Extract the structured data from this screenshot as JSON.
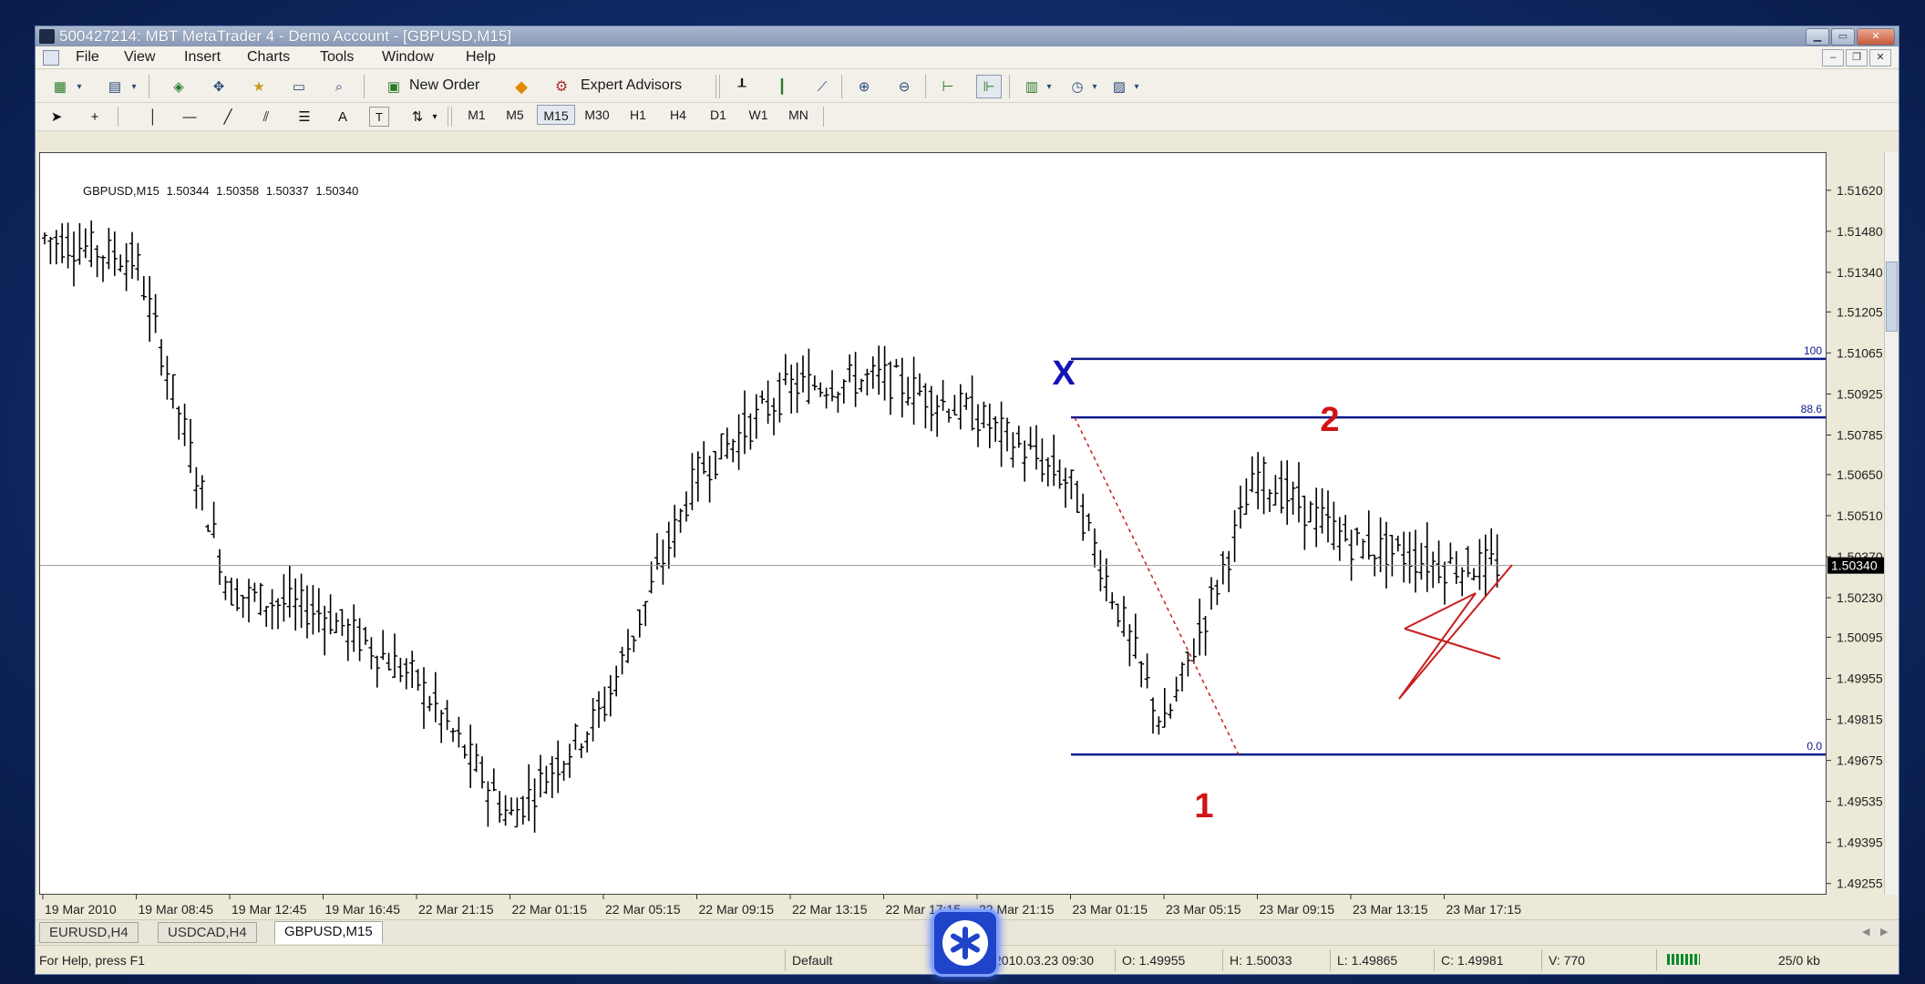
{
  "window": {
    "title": "500427214: MBT MetaTrader 4 - Demo Account - [GBPUSD,M15]",
    "controls": [
      "minimize",
      "maximize",
      "close"
    ]
  },
  "menu": [
    "File",
    "View",
    "Insert",
    "Charts",
    "Tools",
    "Window",
    "Help"
  ],
  "toolbar": {
    "new_order": "New Order",
    "expert_advisors": "Expert Advisors",
    "text_tool": "A",
    "timeframes": [
      "M1",
      "M5",
      "M15",
      "M30",
      "H1",
      "H4",
      "D1",
      "W1",
      "MN"
    ],
    "active_timeframe": "M15"
  },
  "chart": {
    "symbol_line": {
      "symbol": "GBPUSD,M15",
      "open": "1.50344",
      "high": "1.50358",
      "low": "1.50337",
      "close": "1.50340"
    },
    "current_price": "1.50340",
    "price_ticks": [
      "1.51620",
      "1.51480",
      "1.51340",
      "1.51205",
      "1.51065",
      "1.50925",
      "1.50785",
      "1.50650",
      "1.50510",
      "1.50370",
      "1.50230",
      "1.50095",
      "1.49955",
      "1.49815",
      "1.49675",
      "1.49535",
      "1.49395",
      "1.49255"
    ],
    "time_ticks": [
      "19 Mar 2010",
      "19 Mar 08:45",
      "19 Mar 12:45",
      "19 Mar 16:45",
      "22 Mar 21:15",
      "22 Mar 01:15",
      "22 Mar 05:15",
      "22 Mar 09:15",
      "22 Mar 13:15",
      "22 Mar 17:15",
      "22 Mar 21:15",
      "23 Mar 01:15",
      "23 Mar 05:15",
      "23 Mar 09:15",
      "23 Mar 13:15",
      "23 Mar 17:15"
    ],
    "fib_levels": [
      {
        "label": "100",
        "price": 1.51045
      },
      {
        "label": "88.6",
        "price": 1.50845
      },
      {
        "label": "0.0",
        "price": 1.49695
      }
    ],
    "annotations": {
      "x": "X",
      "p1": "1",
      "p2": "2"
    },
    "colors": {
      "fib": "#0b1a8c",
      "label_x": "#1414b4",
      "label_red": "#d11414",
      "triangle": "#c81e1e",
      "bars": "#000000"
    }
  },
  "chart_data": {
    "type": "ohlc",
    "symbol": "GBPUSD",
    "timeframe": "M15",
    "ylim": [
      1.4922,
      1.5175
    ],
    "y_ticks": [
      1.5162,
      1.5148,
      1.5134,
      1.51205,
      1.51065,
      1.50925,
      1.50785,
      1.5065,
      1.5051,
      1.5037,
      1.5023,
      1.50095,
      1.49955,
      1.49815,
      1.49675,
      1.49535,
      1.49395,
      1.49255
    ],
    "close_path": [
      {
        "t": "19 Mar 2010",
        "p": 1.5146
      },
      {
        "t": "19 Mar 08:45",
        "p": 1.5138
      },
      {
        "t": "19 Mar 12:45",
        "p": 1.5025
      },
      {
        "t": "19 Mar 16:45",
        "p": 1.5018
      },
      {
        "t": "22 Mar 21:15",
        "p": 1.4995
      },
      {
        "t": "22 Mar 01:15",
        "p": 1.4948
      },
      {
        "t": "22 Mar 05:15",
        "p": 1.4985
      },
      {
        "t": "22 Mar 09:15",
        "p": 1.5065
      },
      {
        "t": "22 Mar 13:15",
        "p": 1.5095
      },
      {
        "t": "22 Mar 17:15",
        "p": 1.5098
      },
      {
        "t": "22 Mar 21:15",
        "p": 1.5085
      },
      {
        "t": "23 Mar 01:15",
        "p": 1.5062
      },
      {
        "t": "23 Mar 05:15",
        "p": 1.4978
      },
      {
        "t": "23 Mar 09:15",
        "p": 1.5065
      },
      {
        "t": "23 Mar 13:15",
        "p": 1.5042
      },
      {
        "t": "23 Mar 17:15",
        "p": 1.5034
      }
    ],
    "horizontal_line": 1.5034,
    "grid": false
  },
  "tabs": [
    "EURUSD,H4",
    "USDCAD,H4",
    "GBPUSD,M15"
  ],
  "active_tab": "GBPUSD,M15",
  "status": {
    "hint": "For Help, press F1",
    "profile": "Default",
    "datetime": "2010.03.23 09:30",
    "open": "O: 1.49955",
    "high": "H: 1.50033",
    "low": "L: 1.49865",
    "close": "C: 1.49981",
    "volume": "V: 770",
    "traffic": "25/0 kb"
  }
}
